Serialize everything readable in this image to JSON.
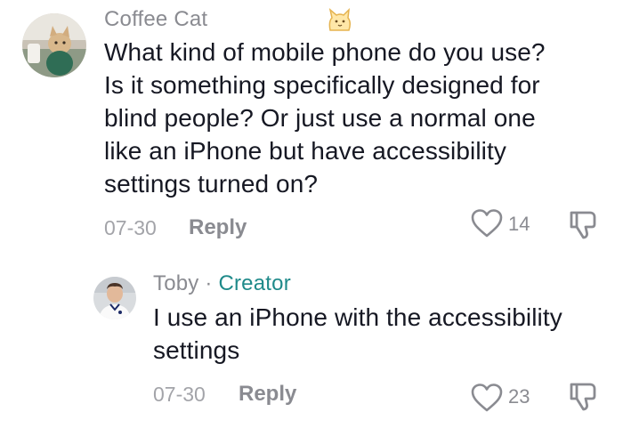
{
  "comments": [
    {
      "author": "Coffee Cat",
      "text_lines": [
        "What kind of mobile phone do you use?",
        "Is it something specifically designed for",
        "blind people? Or just use a normal one",
        "like an iPhone but have accessibility",
        "settings turned on?"
      ],
      "date": "07-30",
      "reply_label": "Reply",
      "likes": "14",
      "badge_icon": "cat-emoji-icon"
    }
  ],
  "replies": [
    {
      "author": "Toby",
      "separator": "·",
      "role": "Creator",
      "text_lines": [
        "I use an iPhone with the accessibility",
        "settings"
      ],
      "date": "07-30",
      "reply_label": "Reply",
      "likes": "23"
    }
  ],
  "colors": {
    "creator": "#1f8a8a",
    "meta": "#8a8b91",
    "text": "#161823"
  }
}
